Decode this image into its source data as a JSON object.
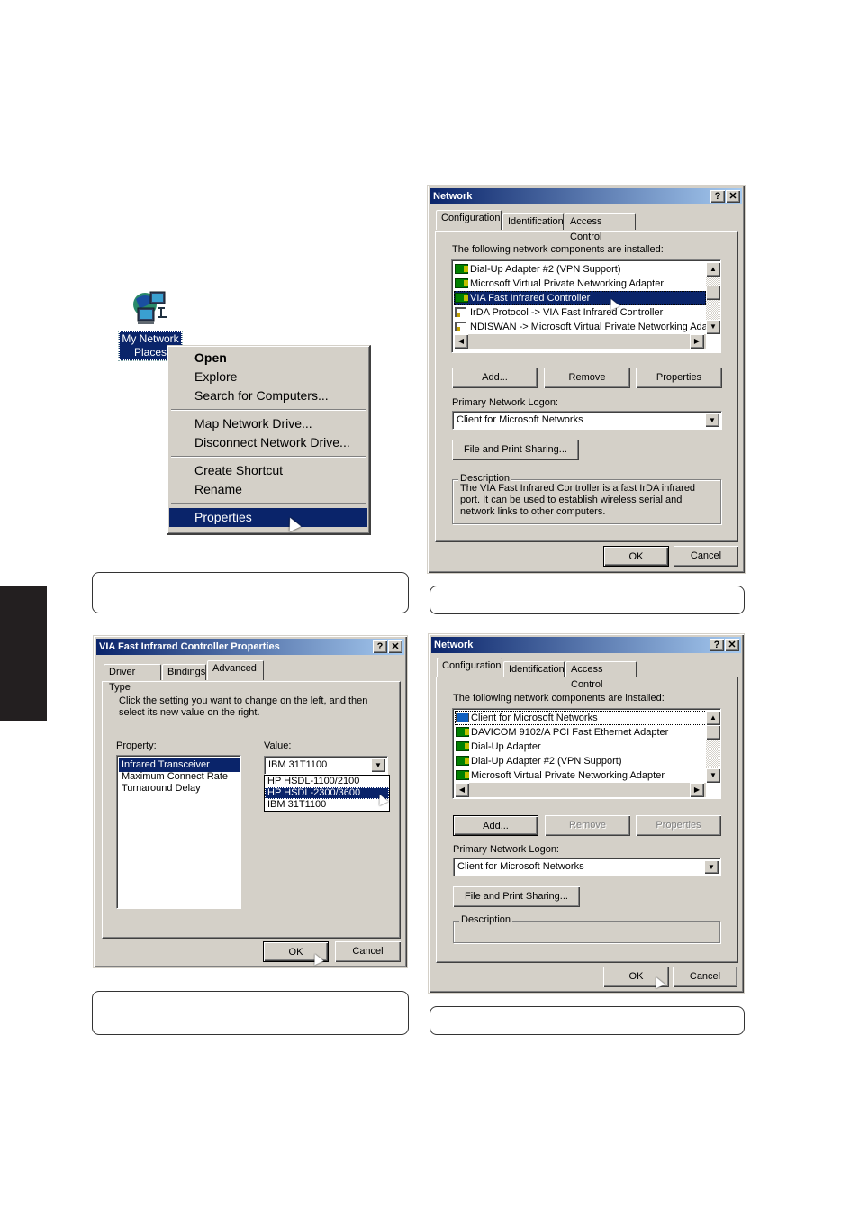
{
  "desktop": {
    "icon_name": "network-places-icon",
    "icon_label_line1": "My Network",
    "icon_label_line2": "Places"
  },
  "context_menu": {
    "items": [
      {
        "label": "Open",
        "bold": true
      },
      {
        "label": "Explore"
      },
      {
        "label": "Search for Computers..."
      },
      {
        "separator": true
      },
      {
        "label": "Map Network Drive..."
      },
      {
        "label": "Disconnect Network Drive..."
      },
      {
        "separator": true
      },
      {
        "label": "Create Shortcut"
      },
      {
        "label": "Rename"
      },
      {
        "separator": true
      },
      {
        "label": "Properties",
        "selected": true
      }
    ],
    "i0": "Open",
    "i1": "Explore",
    "i2": "Search for Computers...",
    "i3": "Map Network Drive...",
    "i4": "Disconnect Network Drive...",
    "i5": "Create Shortcut",
    "i6": "Rename",
    "i7": "Properties"
  },
  "network_dialog_1": {
    "title": "Network",
    "help_glyph": "?",
    "close_glyph": "✕",
    "tabs": [
      "Configuration",
      "Identification",
      "Access Control"
    ],
    "active_tab": "Configuration",
    "components_label": "The following network components are installed:",
    "components": [
      {
        "icon": "network-adapter-icon",
        "label": "Dial-Up Adapter #2 (VPN Support)"
      },
      {
        "icon": "network-adapter-icon",
        "label": "Microsoft Virtual Private Networking Adapter"
      },
      {
        "icon": "network-adapter-icon",
        "label": "VIA Fast Infrared Controller",
        "selected": true
      },
      {
        "icon": "protocol-icon",
        "label": "IrDA Protocol -> VIA Fast Infrared Controller"
      },
      {
        "icon": "protocol-icon",
        "label": "NDISWAN -> Microsoft Virtual Private Networking Adapter"
      }
    ],
    "buttons": {
      "add": "Add...",
      "remove": "Remove",
      "properties": "Properties"
    },
    "logon_label": "Primary Network Logon:",
    "logon_value": "Client for Microsoft Networks",
    "file_print_button": "File and Print Sharing...",
    "description_title": "Description",
    "description_text": "The VIA Fast Infrared Controller is a fast IrDA infrared port.  It can be used to establish wireless serial and network links to other computers.",
    "ok": "OK",
    "cancel": "Cancel"
  },
  "properties_dialog": {
    "title": "VIA Fast Infrared Controller Properties",
    "help_glyph": "?",
    "close_glyph": "✕",
    "tabs": [
      "Driver Type",
      "Bindings",
      "Advanced"
    ],
    "active_tab": "Advanced",
    "instructions": "Click the setting you want to change on the left, and then select its new value on the right.",
    "property_label": "Property:",
    "properties": [
      {
        "label": "Infrared Transceiver",
        "selected": true
      },
      {
        "label": "Maximum Connect Rate"
      },
      {
        "label": "Turnaround Delay"
      }
    ],
    "value_label": "Value:",
    "value_current": "IBM 31T1100",
    "value_options": [
      {
        "label": "HP HSDL-1100/2100"
      },
      {
        "label": "HP HSDL-2300/3600",
        "highlighted": true
      },
      {
        "label": "IBM 31T1100"
      }
    ],
    "ok": "OK",
    "cancel": "Cancel"
  },
  "network_dialog_2": {
    "title": "Network",
    "help_glyph": "?",
    "close_glyph": "✕",
    "tabs": [
      "Configuration",
      "Identification",
      "Access Control"
    ],
    "active_tab": "Configuration",
    "components_label": "The following network components are installed:",
    "components": [
      {
        "icon": "client-icon",
        "label": "Client for Microsoft Networks",
        "focused": true
      },
      {
        "icon": "network-adapter-icon",
        "label": "DAVICOM 9102/A PCI Fast Ethernet Adapter"
      },
      {
        "icon": "network-adapter-icon",
        "label": "Dial-Up Adapter"
      },
      {
        "icon": "network-adapter-icon",
        "label": "Dial-Up Adapter #2 (VPN Support)"
      },
      {
        "icon": "network-adapter-icon",
        "label": "Microsoft Virtual Private Networking Adapter"
      }
    ],
    "buttons": {
      "add": "Add...",
      "remove": "Remove",
      "properties": "Properties"
    },
    "logon_label": "Primary Network Logon:",
    "logon_value": "Client for Microsoft Networks",
    "file_print_button": "File and Print Sharing...",
    "description_title": "Description",
    "description_text": "",
    "ok": "OK",
    "cancel": "Cancel"
  },
  "glyphs": {
    "up": "▲",
    "down": "▼",
    "left": "◀",
    "right": "▶"
  }
}
